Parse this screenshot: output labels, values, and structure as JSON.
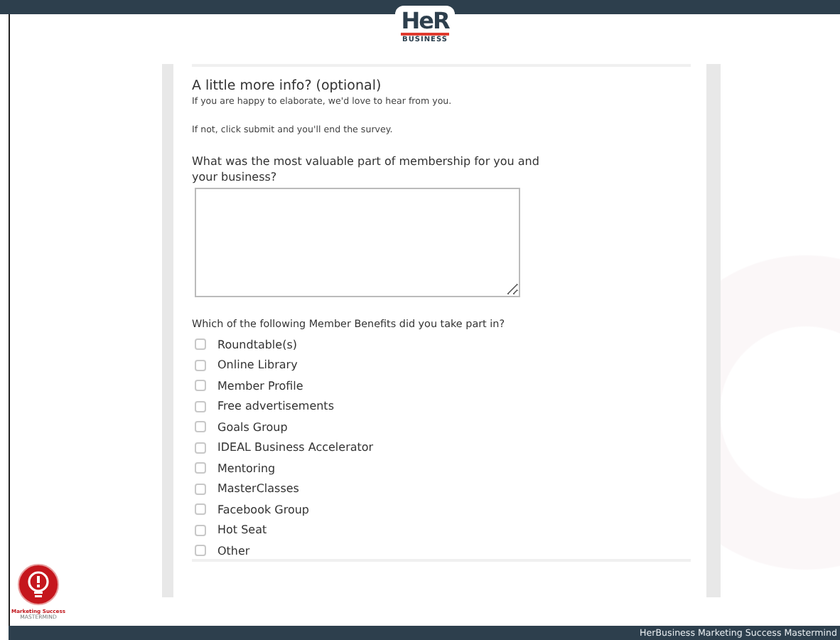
{
  "header": {
    "logo_mark": "HeR",
    "logo_subtitle": "BUSINESS"
  },
  "survey": {
    "title": "A little more info? (optional)",
    "intro": [
      "If you are happy to elaborate, we'd love to hear from you.",
      "If not, click submit and you'll end the survey."
    ],
    "question_1": {
      "label": "What was the most valuable part of membership for you and your business?"
    },
    "question_2": {
      "label": "Which of the following Member Benefits did you take part in?",
      "options": [
        {
          "label": "Roundtable(s)",
          "checked": false
        },
        {
          "label": "Online Library",
          "checked": false
        },
        {
          "label": "Member Profile",
          "checked": false
        },
        {
          "label": "Free advertisements",
          "checked": false
        },
        {
          "label": "Goals Group",
          "checked": false
        },
        {
          "label": "IDEAL Business Accelerator",
          "checked": false
        },
        {
          "label": "Mentoring",
          "checked": false
        },
        {
          "label": "MasterClasses",
          "checked": false
        },
        {
          "label": "Facebook Group",
          "checked": false
        },
        {
          "label": "Hot Seat",
          "checked": false
        },
        {
          "label": "Other",
          "checked": false
        }
      ]
    }
  },
  "badge": {
    "line_1": "Marketing Success",
    "line_2": "MASTERMIND"
  },
  "footer": {
    "text": "HerBusiness Marketing Success Mastermind"
  }
}
